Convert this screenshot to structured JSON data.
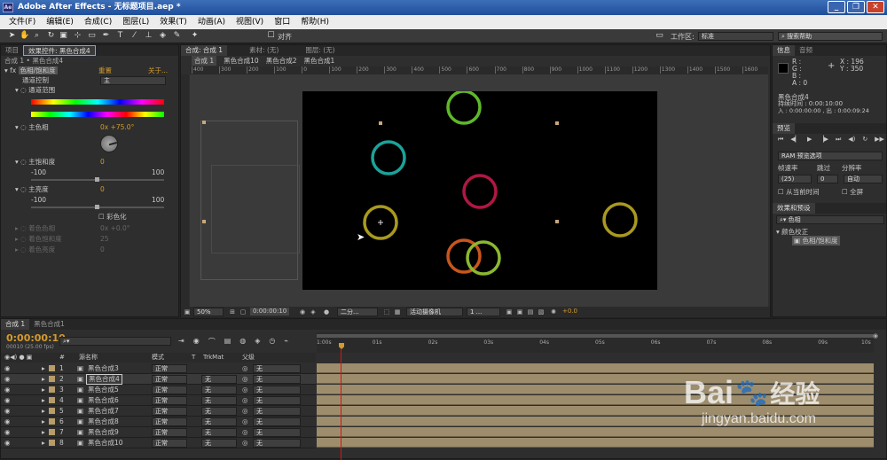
{
  "window": {
    "title": "Adobe After Effects - 无标题项目.aep *",
    "app_icon": "Ae"
  },
  "menubar": [
    "文件(F)",
    "编辑(E)",
    "合成(C)",
    "图层(L)",
    "效果(T)",
    "动画(A)",
    "视图(V)",
    "窗口",
    "帮助(H)"
  ],
  "toolbar": {
    "snap_label": "对齐",
    "workspace_label": "工作区:",
    "workspace_value": "标准",
    "search_placeholder": "搜索帮助"
  },
  "left_panel": {
    "tabs": [
      "项目",
      "效果控件: 黑色合成4"
    ],
    "breadcrumb": "合成 1 • 黑色合成4",
    "effect_name": "色相/饱和度",
    "reset_label": "重置",
    "about_label": "关于...",
    "channel_control_label": "通道控制",
    "channel_control_value": "主",
    "channel_range_label": "通道范围",
    "master_hue_label": "主色相",
    "master_hue_value": "0x +75.0°",
    "master_sat_label": "主饱和度",
    "master_sat_value": "0",
    "master_light_label": "主亮度",
    "master_light_value": "0",
    "range_min": "-100",
    "range_max": "100",
    "colorize_label": "彩色化",
    "colorize_hue_label": "着色色相",
    "colorize_hue_value": "0x +0.0°",
    "colorize_sat_label": "着色饱和度",
    "colorize_sat_value": "25",
    "colorize_light_label": "着色亮度",
    "colorize_light_value": "0"
  },
  "viewer": {
    "tabs": [
      "合成: 合成 1",
      "素材: (无)",
      "图层: (无)"
    ],
    "breadcrumbs": [
      "合成 1",
      "黑色合成10",
      "黑色合成2",
      "黑色合成1"
    ],
    "ruler_ticks": [
      "400",
      "300",
      "200",
      "100",
      "0",
      "100",
      "200",
      "300",
      "400",
      "500",
      "600",
      "700",
      "800",
      "900",
      "1000",
      "1100",
      "1200",
      "1300",
      "1400",
      "1500",
      "1600"
    ],
    "zoom": "50%",
    "time": "0:00:00:10",
    "resolution": "二分...",
    "camera": "活动摄像机",
    "views": "1 ...",
    "exposure": "+0.0"
  },
  "right_panel": {
    "info_tabs": [
      "信息",
      "音频"
    ],
    "rgb": [
      "R :",
      "G :",
      "B :",
      "A : 0"
    ],
    "xy": [
      "X : 196",
      "Y : 350"
    ],
    "comp_name": "黑色合成4",
    "duration": "持续时间 : 0:00:10:00",
    "in_out": "入 : 0:00:00:00 , 出 : 0:00:09:24",
    "preview_tab": "预览",
    "ram_preview": "RAM 预览选项",
    "fps_label": "帧速率",
    "skip_label": "跳过",
    "res_label": "分辨率",
    "fps_value": "(25)",
    "skip_value": "0",
    "res_value": "自动",
    "from_current": "从当前时间",
    "fullscreen": "全屏",
    "effects_tab": "效果和预设",
    "effects_search": "色相",
    "effects_category": "颜色校正",
    "effects_item": "色相/饱和度"
  },
  "timeline": {
    "tabs": [
      "合成 1",
      "黑色合成1"
    ],
    "timecode": "0:00:00:10",
    "timecode_sub": "00010 (25.00 fps)",
    "headers": {
      "source": "源名称",
      "mode": "模式",
      "t": "T",
      "trkmat": "TrkMat",
      "parent": "父级"
    },
    "ruler": [
      "1:00s",
      "01s",
      "02s",
      "03s",
      "04s",
      "05s",
      "06s",
      "07s",
      "08s",
      "09s",
      "10s"
    ],
    "layers": [
      {
        "num": "1",
        "name": "黑色合成3",
        "mode": "正常",
        "trkmat": "",
        "parent": "无"
      },
      {
        "num": "2",
        "name": "黑色合成4",
        "mode": "正常",
        "trkmat": "无",
        "parent": "无"
      },
      {
        "num": "3",
        "name": "黑色合成5",
        "mode": "正常",
        "trkmat": "无",
        "parent": "无"
      },
      {
        "num": "4",
        "name": "黑色合成6",
        "mode": "正常",
        "trkmat": "无",
        "parent": "无"
      },
      {
        "num": "5",
        "name": "黑色合成7",
        "mode": "正常",
        "trkmat": "无",
        "parent": "无"
      },
      {
        "num": "6",
        "name": "黑色合成8",
        "mode": "正常",
        "trkmat": "无",
        "parent": "无"
      },
      {
        "num": "7",
        "name": "黑色合成9",
        "mode": "正常",
        "trkmat": "无",
        "parent": "无"
      },
      {
        "num": "8",
        "name": "黑色合成10",
        "mode": "正常",
        "trkmat": "无",
        "parent": "无"
      }
    ]
  },
  "watermark": {
    "brand": "Bai",
    "brand2": "经验",
    "url": "jingyan.baidu.com"
  },
  "colors": {
    "accent": "#d49b2b",
    "ring_green": "#5fb82a",
    "ring_teal": "#1aa39a",
    "ring_red": "#b01844",
    "ring_olive": "#a99a1f",
    "ring_orange": "#c8561c",
    "ring_lime": "#8cb830"
  }
}
